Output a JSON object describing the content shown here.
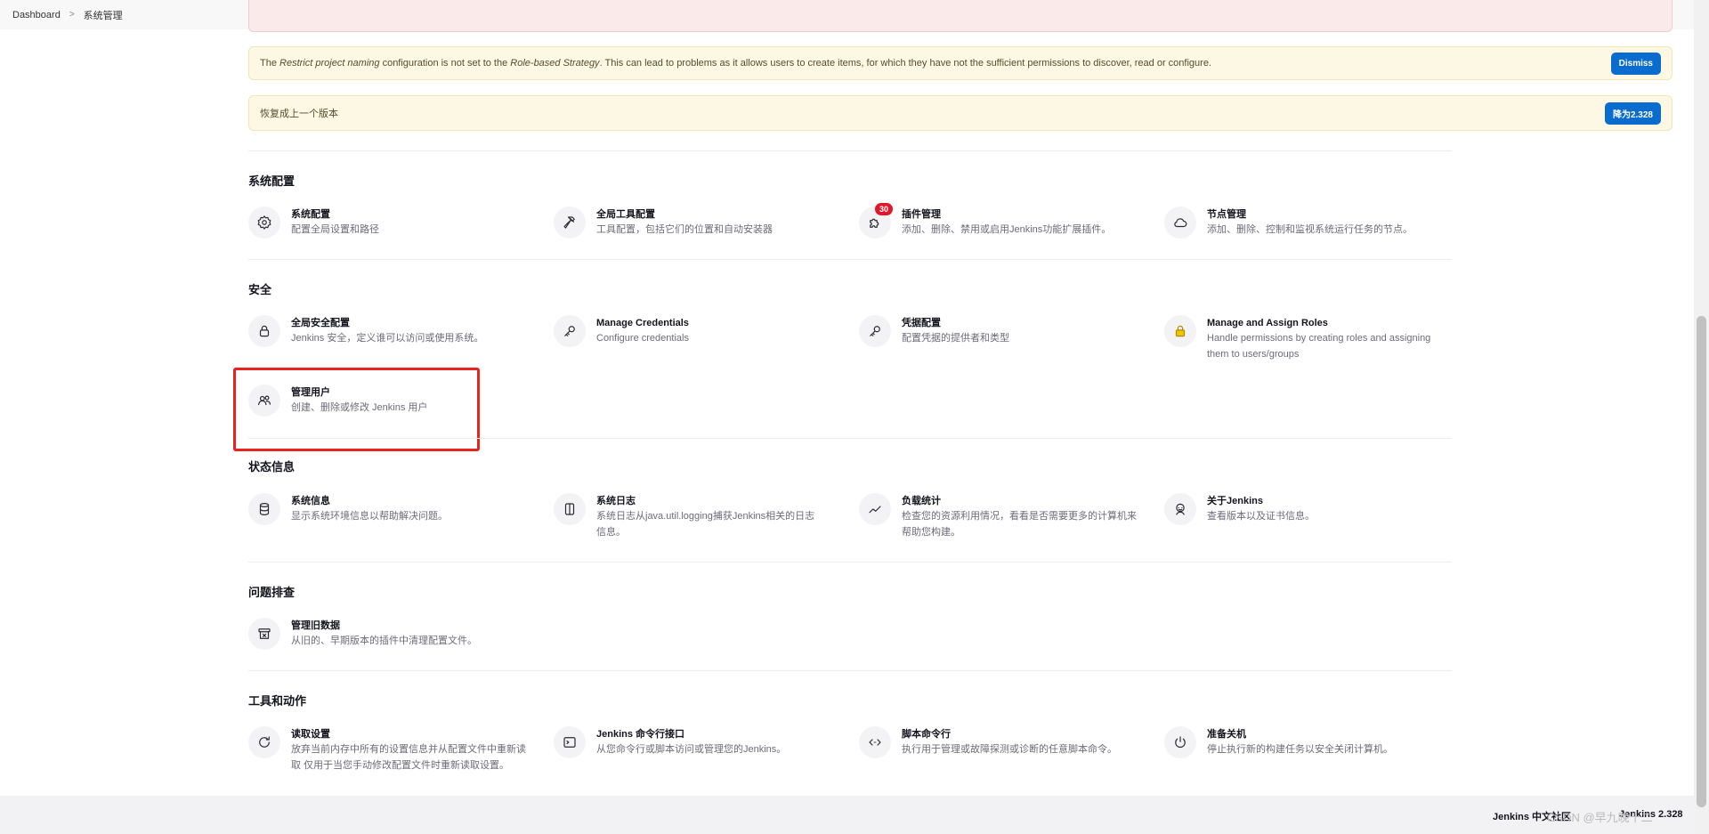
{
  "breadcrumb": {
    "home": "Dashboard",
    "current": "系统管理"
  },
  "notices": {
    "naming": {
      "text_before": "The ",
      "em1": "Restrict project naming",
      "text_mid": " configuration is not set to the ",
      "em2": "Role-based Strategy",
      "text_after": ". This can lead to problems as it allows users to create items, for which they have not the sufficient permissions to discover, read or configure.",
      "button": "Dismiss"
    },
    "downgrade": {
      "text": "恢复成上一个版本",
      "button": "降为2.328"
    }
  },
  "sections": {
    "config": {
      "title": "系统配置",
      "items": [
        {
          "title": "系统配置",
          "desc": "配置全局设置和路径",
          "icon": "gear-icon"
        },
        {
          "title": "全局工具配置",
          "desc": "工具配置，包括它们的位置和自动安装器",
          "icon": "hammer-icon"
        },
        {
          "title": "插件管理",
          "desc": "添加、删除、禁用或启用Jenkins功能扩展插件。",
          "icon": "puzzle-icon",
          "badge": "30"
        },
        {
          "title": "节点管理",
          "desc": "添加、删除、控制和监视系统运行任务的节点。",
          "icon": "cloud-icon"
        }
      ]
    },
    "security": {
      "title": "安全",
      "items": [
        {
          "title": "全局安全配置",
          "desc": "Jenkins 安全，定义谁可以访问或使用系统。",
          "icon": "lock-icon"
        },
        {
          "title": "Manage Credentials",
          "desc": "Configure credentials",
          "icon": "key-icon"
        },
        {
          "title": "凭据配置",
          "desc": "配置凭据的提供者和类型",
          "icon": "key-icon"
        },
        {
          "title": "Manage and Assign Roles",
          "desc1": "Handle permissions by creating roles and assigning",
          "desc2": "them to users/groups",
          "icon": "padlock-icon"
        },
        {
          "title": "管理用户",
          "desc": "创建、删除或修改 Jenkins 用户",
          "icon": "users-icon"
        }
      ]
    },
    "status": {
      "title": "状态信息",
      "items": [
        {
          "title": "系统信息",
          "desc": "显示系统环境信息以帮助解决问题。",
          "icon": "database-icon"
        },
        {
          "title": "系统日志",
          "desc1": "系统日志从java.util.logging捕获Jenkins相关的日志",
          "desc2": "信息。",
          "icon": "log-icon"
        },
        {
          "title": "负载统计",
          "desc1": "检查您的资源利用情况，看看是否需要更多的计算机来",
          "desc2": "帮助您构建。",
          "icon": "chart-icon"
        },
        {
          "title": "关于Jenkins",
          "desc": "查看版本以及证书信息。",
          "icon": "jenkins-icon"
        }
      ]
    },
    "troubleshoot": {
      "title": "问题排查",
      "items": [
        {
          "title": "管理旧数据",
          "desc": "从旧的、早期版本的插件中清理配置文件。",
          "icon": "archive-icon"
        }
      ]
    },
    "tools": {
      "title": "工具和动作",
      "items": [
        {
          "title": "读取设置",
          "desc1": "放弃当前内存中所有的设置信息并从配置文件中重新读",
          "desc2": "取 仅用于当您手动修改配置文件时重新读取设置。",
          "icon": "reload-icon"
        },
        {
          "title": "Jenkins 命令行接口",
          "desc": "从您命令行或脚本访问或管理您的Jenkins。",
          "icon": "terminal-icon"
        },
        {
          "title": "脚本命令行",
          "desc": "执行用于管理或故障探测或诊断的任意脚本命令。",
          "icon": "code-icon"
        },
        {
          "title": "准备关机",
          "desc": "停止执行新的构建任务以安全关闭计算机。",
          "icon": "power-icon"
        }
      ]
    }
  },
  "footer": {
    "community": "Jenkins 中文社区",
    "version": "Jenkins 2.328",
    "watermark": "CSDN @早九晚十二"
  },
  "colors": {
    "primary_button": "#0b6ccf",
    "badge": "#e0182d",
    "highlight_box": "#e8231d",
    "notice_bg": "#fdf8e4"
  }
}
